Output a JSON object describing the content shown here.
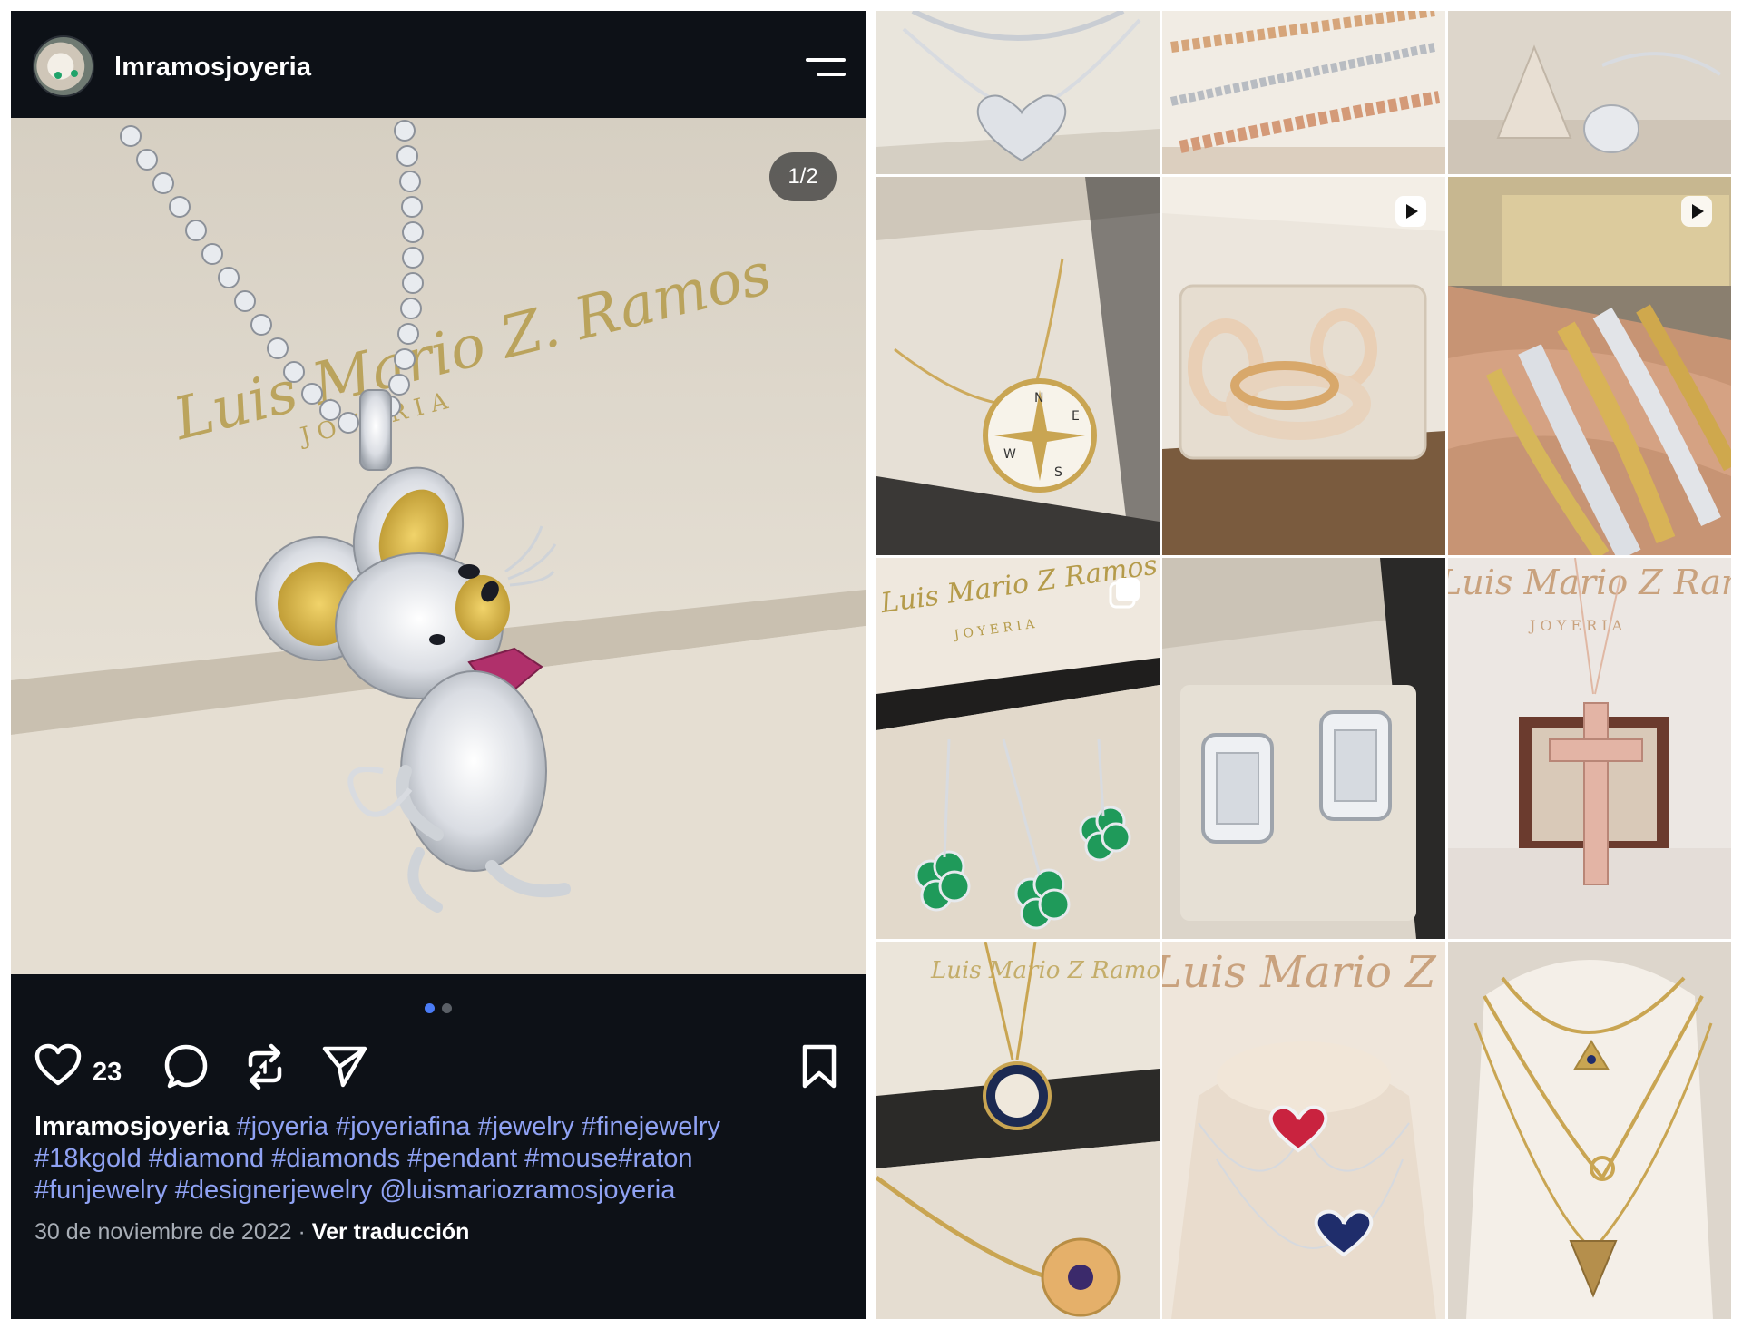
{
  "post": {
    "username": "lmramosjoyeria",
    "image_counter": "1/2",
    "likes": "23",
    "watermark_script": "Luis Mario Z. Ramos",
    "watermark_sub": "J O Y E R I A",
    "caption_user": "lmramosjoyeria",
    "caption_tags": "#joyeria #joyeriafina #jewelry #finejewelry #18kgold #diamond #diamonds #pendant #mouse#raton #funjewelry #designerjewelry @luismariozramosjoyeria",
    "date": "30 de noviembre de 2022",
    "separator": "·",
    "translate_link": "Ver traducción",
    "carousel": {
      "total": 2,
      "active": 0,
      "active_color": "#4a7cf6",
      "inactive_color": "#5a5f66"
    }
  },
  "icons": {
    "menu": "hamburger-menu-icon",
    "like": "heart-icon",
    "comment": "comment-icon",
    "repost": "repost-icon",
    "share": "send-icon",
    "save": "bookmark-icon"
  },
  "grid": {
    "tiles": [
      {
        "subject": "heart pavé diamond necklace",
        "badge": ""
      },
      {
        "subject": "gold and rose chain bracelets",
        "badge": ""
      },
      {
        "subject": "diamond ring on display cone",
        "badge": ""
      },
      {
        "subject": "compass pendant necklace",
        "badge": ""
      },
      {
        "subject": "pavé diamond hoop rings",
        "badge": "play-icon"
      },
      {
        "subject": "stacked diamond bangles on wrist",
        "badge": "play-icon"
      },
      {
        "subject": "emerald clover earrings and pendant",
        "badge": "carousel-icon"
      },
      {
        "subject": "emerald-cut diamond earrings",
        "badge": ""
      },
      {
        "subject": "rose gold diamond cross pendant",
        "badge": ""
      },
      {
        "subject": "compass and evil-eye charm necklaces",
        "badge": ""
      },
      {
        "subject": "ruby and sapphire heart pendants",
        "badge": ""
      },
      {
        "subject": "layered gold charm necklaces",
        "badge": ""
      }
    ],
    "watermarks": [
      "Luis Mario Z Ramos",
      "J O Y E R I A"
    ]
  },
  "colors": {
    "post_bg": "#0d1117",
    "hashtag": "#8fa2f3",
    "meta_text": "#a7adb5"
  }
}
